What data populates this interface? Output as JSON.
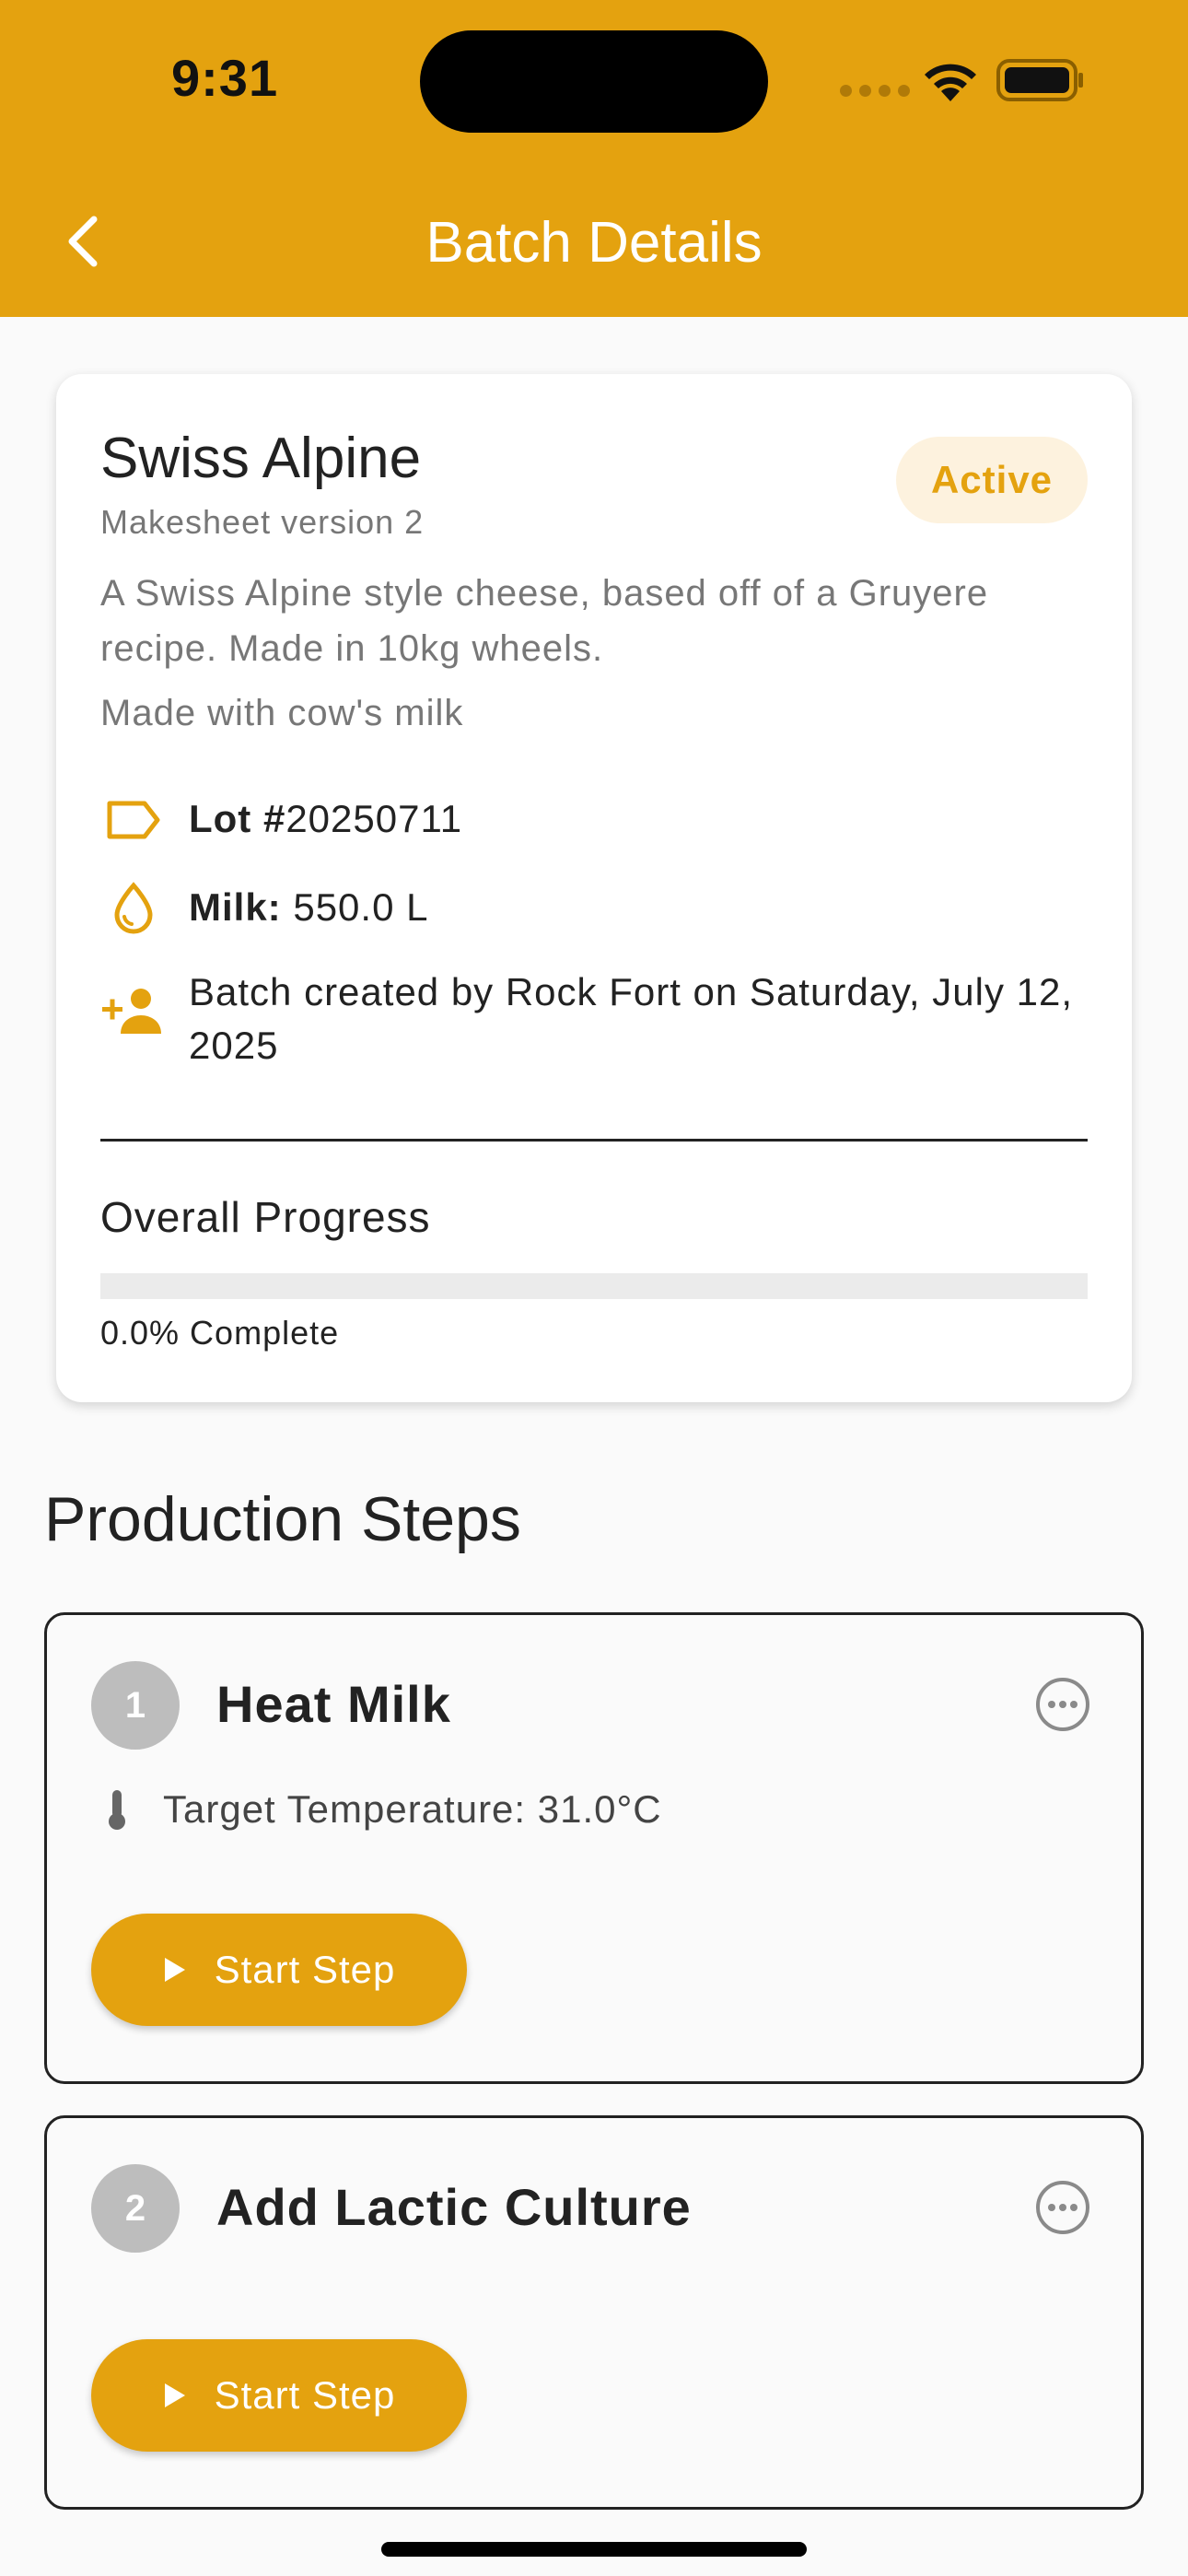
{
  "status_bar": {
    "time": "9:31"
  },
  "header": {
    "title": "Batch Details"
  },
  "batch": {
    "name": "Swiss Alpine",
    "makesheet_version": "Makesheet version 2",
    "status": "Active",
    "description": "A Swiss Alpine style cheese, based off of a Gruyere recipe.  Made in 10kg wheels.",
    "milk_type": "Made with cow's milk",
    "lot_label": "Lot #",
    "lot_value": "20250711",
    "milk_label": "Milk:",
    "milk_value": " 550.0 L",
    "created_text": "Batch created by Rock Fort on Saturday, July 12, 2025",
    "progress_label": "Overall Progress",
    "progress_percent": 0.0,
    "progress_text": "0.0% Complete"
  },
  "production": {
    "title": "Production Steps",
    "steps": [
      {
        "number": "1",
        "name": "Heat Milk",
        "detail": "Target Temperature: 31.0°C",
        "action_label": "Start Step"
      },
      {
        "number": "2",
        "name": "Add Lactic Culture",
        "action_label": "Start Step"
      }
    ]
  },
  "colors": {
    "accent": "#E4A20F",
    "badge_bg": "#FDF2DE",
    "step_number_bg": "#BDBDBD"
  },
  "icons": {
    "back": "chevron-left-icon",
    "lot": "tag-icon",
    "milk": "drop-icon",
    "created": "person-add-icon",
    "temperature": "thermometer-icon",
    "more": "more-horizontal-icon",
    "start": "play-icon"
  }
}
